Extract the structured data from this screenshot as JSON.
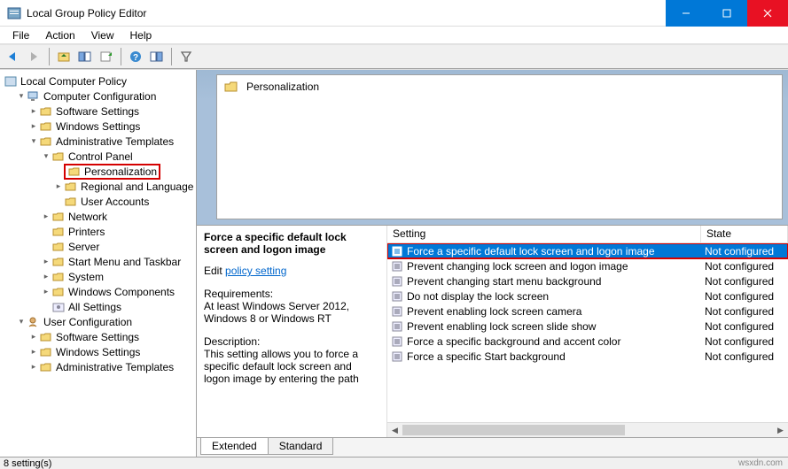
{
  "window": {
    "title": "Local Group Policy Editor"
  },
  "menu": {
    "file": "File",
    "action": "Action",
    "view": "View",
    "help": "Help"
  },
  "tree": {
    "root": "Local Computer Policy",
    "computer_config": "Computer Configuration",
    "software_settings1": "Software Settings",
    "windows_settings1": "Windows Settings",
    "admin_templates1": "Administrative Templates",
    "control_panel": "Control Panel",
    "personalization": "Personalization",
    "regional_lang": "Regional and Language",
    "user_accounts": "User Accounts",
    "network": "Network",
    "printers": "Printers",
    "server": "Server",
    "start_taskbar": "Start Menu and Taskbar",
    "system": "System",
    "windows_components": "Windows Components",
    "all_settings": "All Settings",
    "user_config": "User Configuration",
    "software_settings2": "Software Settings",
    "windows_settings2": "Windows Settings",
    "admin_templates2": "Administrative Templates"
  },
  "preview": {
    "category_label": "Personalization"
  },
  "details": {
    "title": "Force a specific default lock screen and logon image",
    "edit_prefix": "Edit ",
    "edit_link": "policy setting",
    "req_label": "Requirements:",
    "req_text": "At least Windows Server 2012, Windows 8 or Windows RT",
    "desc_label": "Description:",
    "desc_text": "This setting allows you to force a specific default lock screen and logon image by entering the path"
  },
  "table": {
    "header_setting": "Setting",
    "header_state": "State",
    "rows": [
      {
        "label": "Force a specific default lock screen and logon image",
        "state": "Not configured"
      },
      {
        "label": "Prevent changing lock screen and logon image",
        "state": "Not configured"
      },
      {
        "label": "Prevent changing start menu background",
        "state": "Not configured"
      },
      {
        "label": "Do not display the lock screen",
        "state": "Not configured"
      },
      {
        "label": "Prevent enabling lock screen camera",
        "state": "Not configured"
      },
      {
        "label": "Prevent enabling lock screen slide show",
        "state": "Not configured"
      },
      {
        "label": "Force a specific background and accent color",
        "state": "Not configured"
      },
      {
        "label": "Force a specific Start background",
        "state": "Not configured"
      }
    ]
  },
  "tabs": {
    "extended": "Extended",
    "standard": "Standard"
  },
  "status": {
    "text": "8 setting(s)",
    "watermark": "wsxdn.com"
  }
}
